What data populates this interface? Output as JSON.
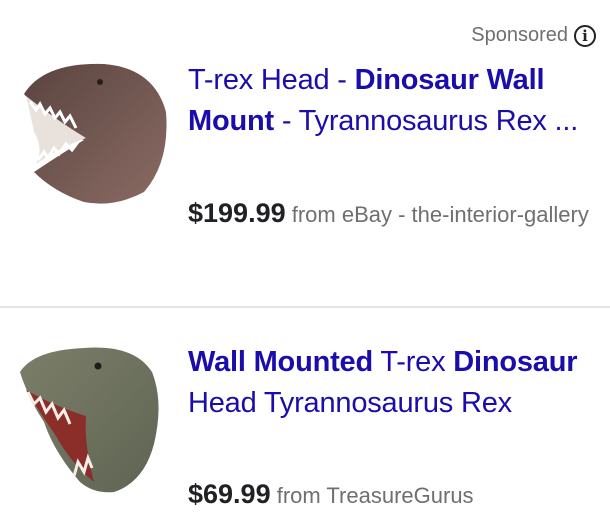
{
  "sponsored_label": "Sponsored",
  "results": [
    {
      "title_parts": [
        {
          "text": "T-rex Head - ",
          "bold": false
        },
        {
          "text": "Dinosaur Wall Mount",
          "bold": true
        },
        {
          "text": " - Tyrannosaurus Rex ...",
          "bold": false
        }
      ],
      "price": "$199.99",
      "source": "from eBay - the-interior-gallery",
      "image": "trex-head-wall-mount-thumbnail"
    },
    {
      "title_parts": [
        {
          "text": "Wall Mounted",
          "bold": true
        },
        {
          "text": " T-rex ",
          "bold": false
        },
        {
          "text": "Dinosaur",
          "bold": true
        },
        {
          "text": " Head Tyrannosaurus Rex",
          "bold": false
        }
      ],
      "price": "$69.99",
      "source": "from TreasureGurus",
      "image": "trex-head-green-thumbnail"
    }
  ],
  "colors": {
    "link": "#1a0dab",
    "muted": "#6f6f6f",
    "price": "#202124"
  }
}
